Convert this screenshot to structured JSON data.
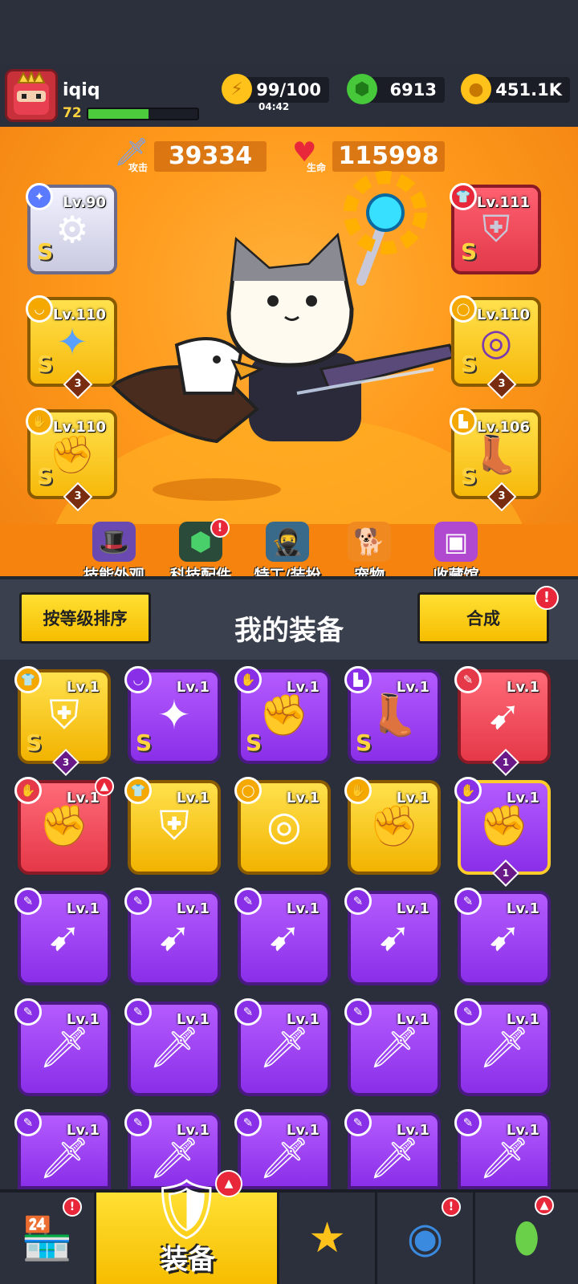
{
  "player": {
    "name": "iqiq",
    "level": "72",
    "xp_fraction": 0.55
  },
  "resources": {
    "energy": "99/100",
    "energy_timer": "04:42",
    "gems": "6913",
    "coins": "451.1K"
  },
  "stats": {
    "attack_label": "攻击",
    "attack": "39334",
    "hp_label": "生命",
    "hp": "115998"
  },
  "equipped": {
    "left": [
      {
        "level": "Lv.90",
        "grade": "S",
        "stars": "",
        "icon": "staff-icon"
      },
      {
        "level": "Lv.110",
        "grade": "S",
        "stars": "3",
        "icon": "necklace-icon"
      },
      {
        "level": "Lv.110",
        "grade": "S",
        "stars": "3",
        "icon": "gauntlet-icon"
      }
    ],
    "right": [
      {
        "level": "Lv.111",
        "grade": "S",
        "stars": "",
        "icon": "armor-icon"
      },
      {
        "level": "Lv.110",
        "grade": "S",
        "stars": "3",
        "icon": "belt-icon"
      },
      {
        "level": "Lv.106",
        "grade": "S",
        "stars": "3",
        "icon": "boots-icon"
      }
    ]
  },
  "menu": [
    {
      "label": "技能外观"
    },
    {
      "label": "科技配件"
    },
    {
      "label": "特工/装扮"
    },
    {
      "label": "宠物"
    },
    {
      "label": "收藏馆"
    }
  ],
  "equipment_bar": {
    "sort_label": "按等级排序",
    "title": "我的装备",
    "merge_label": "合成"
  },
  "grid": {
    "level_label": "Lv.1",
    "rows": [
      [
        {
          "rarity": "gold",
          "grade": "S",
          "num": "3",
          "icon": "armor-icon"
        },
        {
          "rarity": "purple",
          "grade": "S",
          "num": "",
          "icon": "necklace-icon"
        },
        {
          "rarity": "purple",
          "grade": "S",
          "num": "",
          "icon": "gauntlet-icon"
        },
        {
          "rarity": "purple",
          "grade": "S",
          "num": "",
          "icon": "boots-icon"
        },
        {
          "rarity": "red",
          "grade": "",
          "num": "1",
          "icon": "kunai-icon"
        }
      ],
      [
        {
          "rarity": "red",
          "grade": "",
          "num": "",
          "icon": "gauntlet-icon"
        },
        {
          "rarity": "gold",
          "grade": "",
          "num": "",
          "icon": "armor-icon"
        },
        {
          "rarity": "gold",
          "grade": "",
          "num": "",
          "icon": "belt-icon"
        },
        {
          "rarity": "gold",
          "grade": "",
          "num": "",
          "icon": "gauntlet-icon"
        },
        {
          "rarity": "purple",
          "grade": "",
          "num": "1",
          "icon": "gauntlet-icon"
        }
      ],
      [
        {
          "rarity": "purple",
          "grade": "",
          "num": "",
          "icon": "kunai-icon"
        },
        {
          "rarity": "purple",
          "grade": "",
          "num": "",
          "icon": "kunai-icon"
        },
        {
          "rarity": "purple",
          "grade": "",
          "num": "",
          "icon": "kunai-icon"
        },
        {
          "rarity": "purple",
          "grade": "",
          "num": "",
          "icon": "kunai-icon"
        },
        {
          "rarity": "purple",
          "grade": "",
          "num": "",
          "icon": "kunai-icon"
        }
      ],
      [
        {
          "rarity": "purple",
          "grade": "",
          "num": "",
          "icon": "sword-icon"
        },
        {
          "rarity": "purple",
          "grade": "",
          "num": "",
          "icon": "sword-icon"
        },
        {
          "rarity": "purple",
          "grade": "",
          "num": "",
          "icon": "sword-icon"
        },
        {
          "rarity": "purple",
          "grade": "",
          "num": "",
          "icon": "sword-icon"
        },
        {
          "rarity": "purple",
          "grade": "",
          "num": "",
          "icon": "sword-icon"
        }
      ],
      [
        {
          "rarity": "purple",
          "grade": "",
          "num": "",
          "icon": "sword-icon"
        },
        {
          "rarity": "purple",
          "grade": "",
          "num": "",
          "icon": "sword-icon"
        },
        {
          "rarity": "purple",
          "grade": "",
          "num": "",
          "icon": "sword-icon"
        },
        {
          "rarity": "purple",
          "grade": "",
          "num": "",
          "icon": "sword-icon"
        },
        {
          "rarity": "purple",
          "grade": "",
          "num": "",
          "icon": "sword-icon"
        }
      ]
    ]
  },
  "bottom_nav": {
    "active_label": "装备",
    "tabs": [
      "shop-icon",
      "equipment-icon",
      "weapons-star-icon",
      "planet-icon",
      "lab-capsule-icon"
    ]
  },
  "colors": {
    "hero_bg": "#ff9a1c",
    "button_yellow": "#f6bd00",
    "rarity_purple": "#a04cf5",
    "rarity_gold": "#f7c10a",
    "rarity_red": "#e53848",
    "notification_red": "#e8283a"
  }
}
